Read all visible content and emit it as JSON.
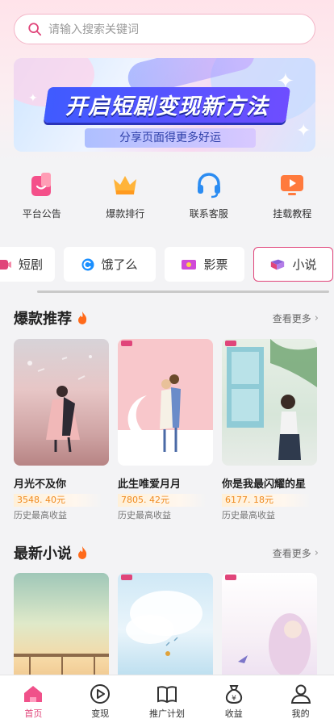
{
  "search": {
    "placeholder": "请输入搜索关键词"
  },
  "banner": {
    "title": "开启短剧变现新方法",
    "subtitle": "分享页面得更多好运"
  },
  "quick_links": [
    {
      "label": "平台公告",
      "icon": "notice-icon"
    },
    {
      "label": "爆款排行",
      "icon": "crown-icon"
    },
    {
      "label": "联系客服",
      "icon": "headset-icon"
    },
    {
      "label": "挂载教程",
      "icon": "play-screen-icon"
    }
  ],
  "categories": [
    {
      "label": "短剧",
      "icon": "short-drama-icon"
    },
    {
      "label": "饿了么",
      "icon": "eleme-icon"
    },
    {
      "label": "影票",
      "icon": "movie-ticket-icon"
    },
    {
      "label": "小说",
      "icon": "book-icon",
      "active": true
    }
  ],
  "hot": {
    "title": "爆款推荐",
    "more": "查看更多",
    "items": [
      {
        "title": "月光不及你",
        "price": "3548. 40元",
        "label": "历史最高收益"
      },
      {
        "title": "此生唯爱月月",
        "price": "7805. 42元",
        "label": "历史最高收益"
      },
      {
        "title": "你是我最闪耀的星",
        "price": "6177. 18元",
        "label": "历史最高收益"
      }
    ]
  },
  "latest": {
    "title": "最新小说",
    "more": "查看更多"
  },
  "tabbar": [
    {
      "label": "首页",
      "icon": "home-icon",
      "active": true
    },
    {
      "label": "变现",
      "icon": "play-circle-icon"
    },
    {
      "label": "推广计划",
      "icon": "open-book-icon"
    },
    {
      "label": "收益",
      "icon": "money-bag-icon"
    },
    {
      "label": "我的",
      "icon": "user-icon"
    }
  ],
  "colors": {
    "accent": "#e0457a",
    "price": "#f08a1e"
  }
}
